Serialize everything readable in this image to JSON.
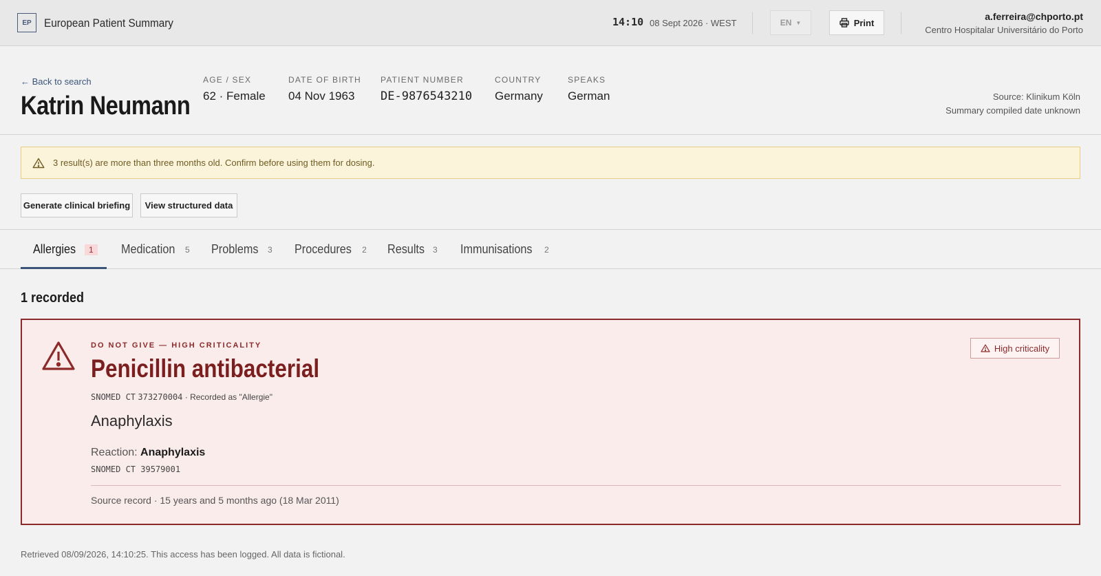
{
  "topbar": {
    "logo": "EP",
    "app_title": "European Patient Summary",
    "time": "14:10",
    "date": "08 Sept 2026 · WEST",
    "language": "EN",
    "print_label": "Print",
    "user_email": "a.ferreira@chporto.pt",
    "user_org": "Centro Hospitalar Universitário do Porto"
  },
  "patient": {
    "back_link": "← Back to search",
    "name": "Katrin Neumann",
    "fields": [
      {
        "label": "AGE / SEX",
        "value": "62 · Female"
      },
      {
        "label": "DATE OF BIRTH",
        "value": "04 Nov 1963"
      },
      {
        "label": "PATIENT NUMBER",
        "value": "DE-9876543210"
      },
      {
        "label": "COUNTRY",
        "value": "Germany"
      },
      {
        "label": "SPEAKS",
        "value": "German"
      }
    ],
    "source": "Source: Klinikum Köln",
    "compiled": "Summary compiled date unknown"
  },
  "warning": {
    "text": "3 result(s) are more than three months old. Confirm before using them for dosing."
  },
  "actions": {
    "briefing": "Generate clinical briefing",
    "structured": "View structured data"
  },
  "tabs": [
    {
      "label": "Allergies",
      "count": "1"
    },
    {
      "label": "Medication",
      "count": "5"
    },
    {
      "label": "Problems",
      "count": "3"
    },
    {
      "label": "Procedures",
      "count": "2"
    },
    {
      "label": "Results",
      "count": "3"
    },
    {
      "label": "Immunisations",
      "count": "2"
    }
  ],
  "section": {
    "recorded": "1 recorded"
  },
  "allergy": {
    "kicker": "DO NOT GIVE — HIGH CRITICALITY",
    "substance": "Penicillin antibacterial",
    "code_system": "SNOMED CT",
    "code": "373270004",
    "recorded_as": "· Recorded as \"Allergie\"",
    "manifestation": "Anaphylaxis",
    "reaction_label": "Reaction:",
    "reaction_value": "Anaphylaxis",
    "reaction_code": "SNOMED CT 39579001",
    "source_record": "Source record · 15 years and 5 months ago (18 Mar 2011)",
    "badge": "High criticality",
    "accent": "#8c2a2a"
  },
  "footer": {
    "text": "Retrieved 08/09/2026, 14:10:25. This access has been logged. All data is fictional."
  }
}
